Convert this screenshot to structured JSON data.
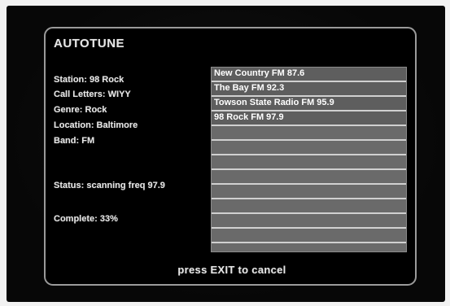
{
  "title": "AUTOTUNE",
  "info": {
    "station": "Station: 98 Rock",
    "call_letters": "Call Letters: WIYY",
    "genre": "Genre: Rock",
    "location": "Location: Baltimore",
    "band": "Band: FM"
  },
  "status": {
    "scanning": "Status: scanning freq 97.9",
    "complete": "Complete: 33%",
    "complete_fraction": 0.33
  },
  "stations": [
    "New Country FM 87.6",
    "The Bay FM 92.3",
    "Towson State Radio FM 95.9",
    "98 Rock FM 97.9",
    "",
    "",
    "",
    "",
    "",
    "",
    "",
    ""
  ],
  "footer": {
    "exit_hint": "press EXIT to cancel"
  }
}
